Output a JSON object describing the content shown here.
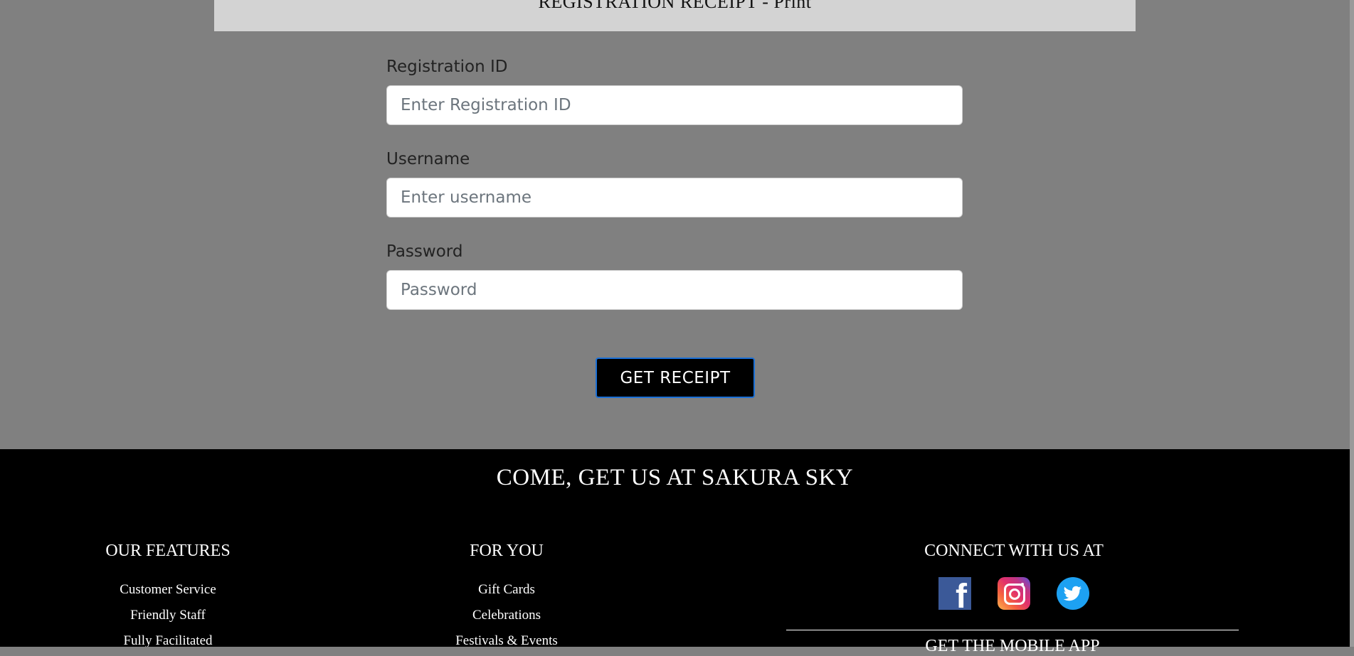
{
  "header": {
    "title": "REGISTRATION RECEIPT - Print"
  },
  "form": {
    "registration_id": {
      "label": "Registration ID",
      "placeholder": "Enter Registration ID",
      "value": ""
    },
    "username": {
      "label": "Username",
      "placeholder": "Enter username",
      "value": ""
    },
    "password": {
      "label": "Password",
      "placeholder": "Password",
      "value": ""
    },
    "submit_label": "GET RECEIPT"
  },
  "footer": {
    "title": "COME, GET US AT SAKURA SKY",
    "features": {
      "title": "OUR FEATURES",
      "items": [
        "Customer Service",
        "Friendly Staff",
        "Fully Facilitated"
      ]
    },
    "for_you": {
      "title": "FOR YOU",
      "items": [
        "Gift Cards",
        "Celebrations",
        "Festivals & Events"
      ]
    },
    "connect": {
      "title": "CONNECT WITH US AT",
      "icons": [
        "facebook-icon",
        "instagram-icon",
        "twitter-icon"
      ],
      "mobile_app": "GET THE MOBILE APP"
    }
  },
  "colors": {
    "page_bg": "#808080",
    "header_bg": "#d3d3d3",
    "footer_bg": "#000000",
    "button_border": "#1a6fd6",
    "facebook": "#3b5998",
    "twitter": "#1da1f2"
  }
}
